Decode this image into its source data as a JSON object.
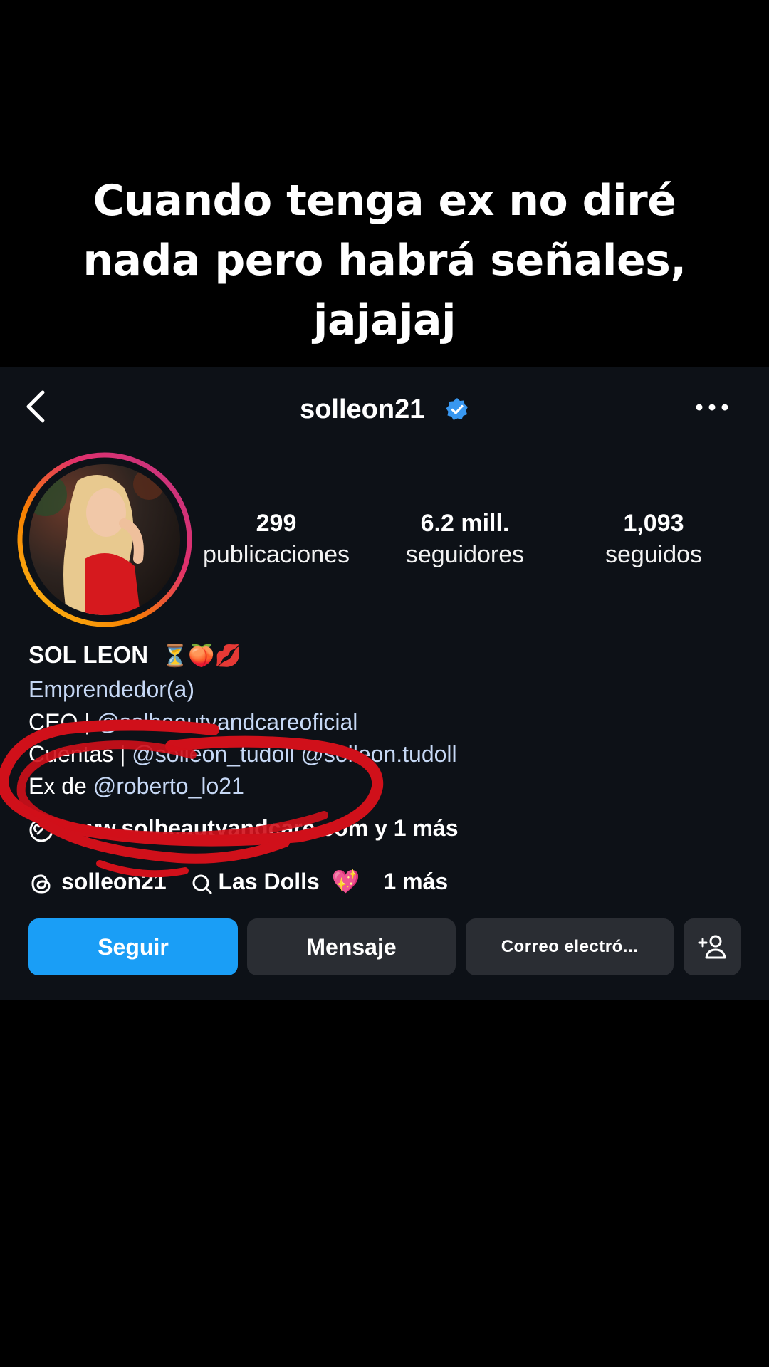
{
  "caption": {
    "line1": "Cuando tenga ex no diré",
    "line2": "nada pero habrá señales,",
    "line3": "jajajaj"
  },
  "header": {
    "username": "solleon21",
    "back_icon": "chevron-left-icon",
    "verified_icon": "verified-badge-icon",
    "more_icon": "more-horizontal-icon"
  },
  "stats": {
    "posts": {
      "value": "299",
      "label": "publicaciones"
    },
    "followers": {
      "value": "6.2 mill.",
      "label": "seguidores"
    },
    "following": {
      "value": "1,093",
      "label": "seguidos"
    }
  },
  "bio": {
    "name": "SOL LEON",
    "emojis": "⏳🍑💋",
    "category": "Emprendedor(a)",
    "line_ceo_prefix": "CEO | ",
    "line_ceo_handle": "@solbeautyandcareoficial",
    "line_accounts_prefix": "Cuentas | ",
    "line_accounts_handle1": "@solleon_tudoll",
    "line_accounts_handle2": "@solleon.tudoll",
    "line_ex_prefix": "Ex de ",
    "line_ex_handle": "@roberto_lo21",
    "website": "www.solbeautyandcare.com y 1 más",
    "threads_handle": "solleon21",
    "group_name": "Las Dolls",
    "group_emoji": "💖",
    "group_more": "1 más"
  },
  "actions": {
    "follow": "Seguir",
    "message": "Mensaje",
    "email": "Correo electró...",
    "add_user_icon": "add-user-icon"
  },
  "colors": {
    "background": "#000000",
    "profile_bg": "#0d1117",
    "follow_blue": "#1a9ef6",
    "link": "#c6d8f5",
    "scribble_red": "#d0101a"
  }
}
